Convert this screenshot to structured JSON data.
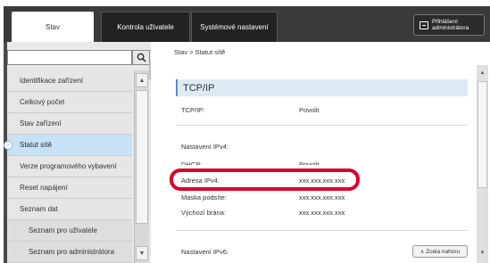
{
  "tabs": [
    {
      "label": "Stav",
      "active": true
    },
    {
      "label": "Kontrola uživatele",
      "active": false
    },
    {
      "label": "Systémové nastavení",
      "active": false
    }
  ],
  "login": {
    "line1": "Přihlášení",
    "line2": "administrátora",
    "icon": "login-icon"
  },
  "search": {
    "value": "",
    "placeholder": "",
    "icon": "search-icon"
  },
  "sidebar": {
    "items": [
      {
        "label": "Identifikace zařízení"
      },
      {
        "label": "Celkový počet"
      },
      {
        "label": "Stav zařízení"
      },
      {
        "label": "Statut sítě",
        "selected": true
      },
      {
        "label": "Verze programového vybavení"
      },
      {
        "label": "Reset napájení"
      },
      {
        "label": "Seznam dat"
      },
      {
        "label": "Seznam pro uživatele"
      },
      {
        "label": "Seznam pro administrátora"
      }
    ]
  },
  "breadcrumb": "Stav > Statut sítě",
  "main": {
    "section_title": "TCP/IP",
    "tcpip_label": "TCP/IP:",
    "tcpip_value": "Povolit",
    "ipv4_heading": "Nastavení IPv4:",
    "dhcp_label": "DHCP:",
    "dhcp_value": "Povolit",
    "ipv4_label": "Adresa IPv4:",
    "ipv4_value": "xxx.xxx.xxx.xxx",
    "mask_label": "Maska podsíte:",
    "mask_value": "xxx.xxx.xxx.xxx",
    "gateway_label": "Výchozí brána:",
    "gateway_value": "xxx.xxx.xxx.xxx",
    "ipv6_heading": "Nastavení IPv6:",
    "top_button": "Zcela nahoru"
  },
  "colors": {
    "highlight": "#d9002a",
    "selected": "#c7e1f5",
    "section_bg": "#dde9f5"
  }
}
